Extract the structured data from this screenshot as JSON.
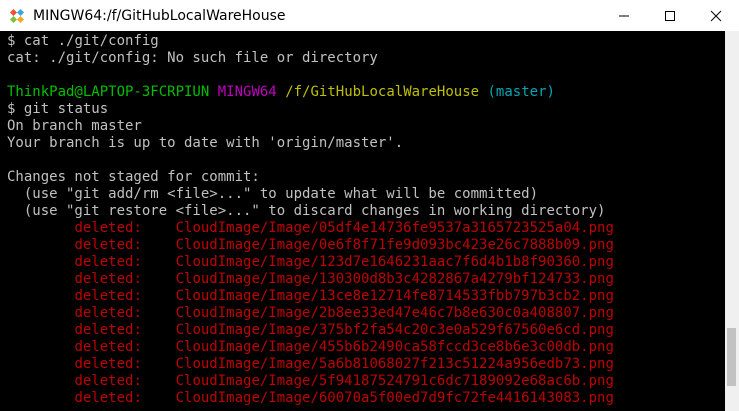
{
  "window": {
    "title": "MINGW64:/f/GitHubLocalWareHouse"
  },
  "controls": {
    "minimize": "—",
    "maximize": "☐",
    "close": "✕"
  },
  "terminal": {
    "prompt_sym": "$",
    "cmd1": "cat ./git/config",
    "err1": "cat: ./git/config: No such file or directory",
    "user_host": "ThinkPad@LAPTOP-3FCRPIUN",
    "env": "MINGW64",
    "path": "/f/GitHubLocalWareHouse",
    "branch": "(master)",
    "cmd2": "git status",
    "out_branch": "On branch master",
    "out_uptodate": "Your branch is up to date with 'origin/master'.",
    "out_changes": "Changes not staged for commit:",
    "hint1": "  (use \"git add/rm <file>...\" to update what will be committed)",
    "hint2": "  (use \"git restore <file>...\" to discard changes in working directory)",
    "deleted_label": "deleted:",
    "deleted_files": [
      "CloudImage/Image/05df4e14736fe9537a3165723525a04.png",
      "CloudImage/Image/0e6f8f71fe9d093bc423e26c7888b09.png",
      "CloudImage/Image/123d7e1646231aac7f6d4b1b8f90360.png",
      "CloudImage/Image/130300d8b3c4282867a4279bf124733.png",
      "CloudImage/Image/13ce8e12714fe8714533fbb797b3cb2.png",
      "CloudImage/Image/2b8ee33ed47e46c7b8e630c0a408807.png",
      "CloudImage/Image/375bf2fa54c20c3e0a529f67560e6cd.png",
      "CloudImage/Image/455b6b2490ca58fccd3ce8b6e3c00db.png",
      "CloudImage/Image/5a6b81068027f213c51224a956edb73.png",
      "CloudImage/Image/5f94187524791c6dc7189092e68ac6b.png",
      "CloudImage/Image/60070a5f00ed7d9fc72fe4416143083.png"
    ]
  }
}
